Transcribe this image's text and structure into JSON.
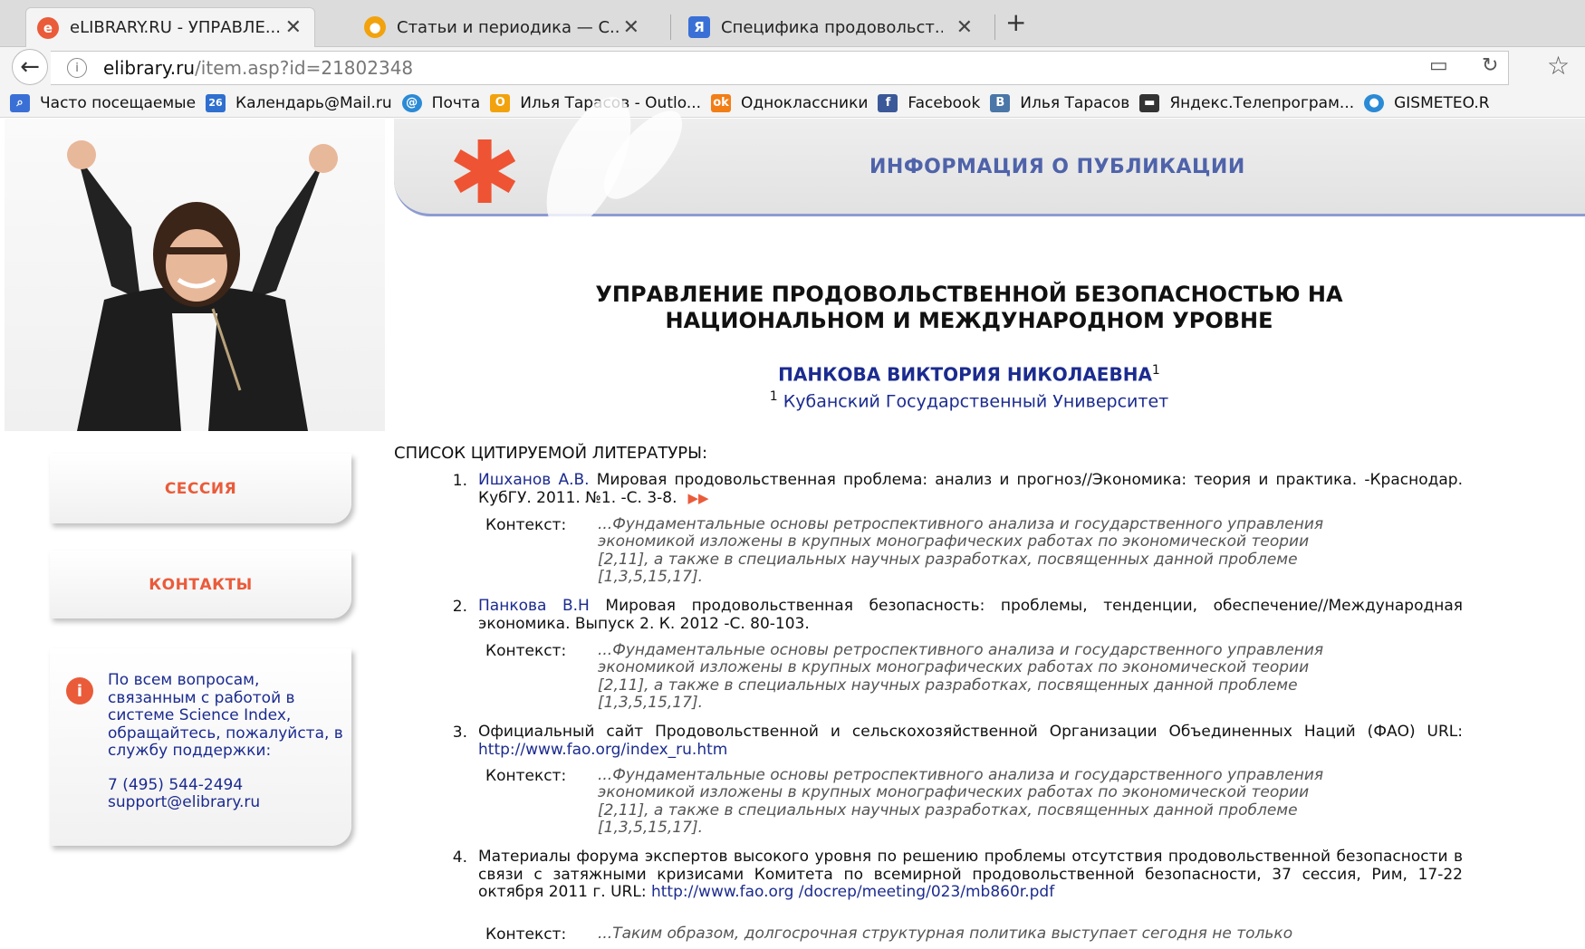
{
  "tabs": [
    {
      "label": "eLIBRARY.RU - УПРАВЛЕ...",
      "icon": "elibrary-icon",
      "color": "#ea5b3a",
      "active": true
    },
    {
      "label": "Статьи и периодика — С...",
      "icon": "globe-icon",
      "color": "#f2a20c",
      "active": false
    },
    {
      "label": "Специфика продовольст...",
      "icon": "document-icon",
      "color": "#3a70d6",
      "active": false
    }
  ],
  "address": {
    "host": "elibrary.ru",
    "path": "/item.asp?id=21802348"
  },
  "bookmarks": [
    {
      "label": "Часто посещаемые",
      "icon": "frequent-icon",
      "color": "#3a70d6"
    },
    {
      "label": "Календарь@Mail.ru",
      "icon": "calendar-icon",
      "color": "#2e6fd0",
      "glyph": "26"
    },
    {
      "label": "Почта",
      "icon": "mail-icon",
      "color": "#2b8ad6"
    },
    {
      "label": "Илья Тарасов - Outlo...",
      "icon": "outlook-icon",
      "color": "#f2a20c"
    },
    {
      "label": "Одноклассники",
      "icon": "odnoklassniki-icon",
      "color": "#f27e16"
    },
    {
      "label": "Facebook",
      "icon": "facebook-icon",
      "color": "#3b5998",
      "glyph": "f"
    },
    {
      "label": "Илья Тарасов",
      "icon": "vk-icon",
      "color": "#4a76a8",
      "glyph": "B"
    },
    {
      "label": "Яндекс.Телепрограм...",
      "icon": "tv-icon",
      "color": "#333333"
    },
    {
      "label": "GISMETEO.R",
      "icon": "gismeteo-icon",
      "color": "#2b8ad6"
    }
  ],
  "header": {
    "title": "ИНФОРМАЦИЯ О ПУБЛИКАЦИИ"
  },
  "publication": {
    "title_line1": "УПРАВЛЕНИЕ ПРОДОВОЛЬСТВЕННОЙ БЕЗОПАСНОСТЬЮ НА",
    "title_line2": "НАЦИОНАЛЬНОМ И МЕЖДУНАРОДНОМ УРОВНЕ",
    "author": "ПАНКОВА ВИКТОРИЯ НИКОЛАЕВНА",
    "author_sup": "1",
    "affil_sup": "1",
    "affiliation": "Кубанский Государственный Университет"
  },
  "sidebar": {
    "session": "СЕССИЯ",
    "contacts": "КОНТАКТЫ",
    "support_text": "По всем вопросам, связанным с работой в системе Science Index, обращайтесь, пожалуйста, в службу поддержки:",
    "phone": "7 (495) 544-2494",
    "email": "support@elibrary.ru"
  },
  "refs_heading": "СПИСОК ЦИТИРУЕМОЙ ЛИТЕРАТУРЫ:",
  "context_label": "Контекст:",
  "context_text": "...Фундаментальные основы ретроспективного анализа и государственного управления экономикой изложены в крупных монографических работах по экономической теории [2,11], а также в специальных научных разработках, посвященных данной проблеме [1,3,5,15,17].",
  "context_text_4": "...Таким образом, долгосрочная структурная политика выступает сегодня не только",
  "references": [
    {
      "num": "1.",
      "link": "Ишханов А.В.",
      "text": " Мировая продовольственная проблема: анализ и прогноз//Экономика: теория и практика. -Краснодар. КубГУ. 2011. №1. -С. 3-8."
    },
    {
      "num": "2.",
      "link": "Панкова В.Н",
      "text": " Мировая продовольственная безопасность: проблемы, тенденции, обеспечение//Международная экономика. Выпуск 2. К. 2012 -С. 80-103."
    },
    {
      "num": "3.",
      "text": "Официальный сайт Продовольственной и сельскохозяйственной Организации Объединенных Наций (ФАО) URL: ",
      "url": "http://www.fao.org/index_ru.htm"
    },
    {
      "num": "4.",
      "text": "Материалы форума экспертов высокого уровня по решению проблемы отсутствия продовольственной безопасности в связи с затяжными кризисами Комитета по всемирной продовольственной безопасности, 37 сессия, Рим, 17-22 октября 2011 г. URL: ",
      "url": "http://www.fao.org /docrep/meeting/023/mb860r.pdf"
    }
  ]
}
